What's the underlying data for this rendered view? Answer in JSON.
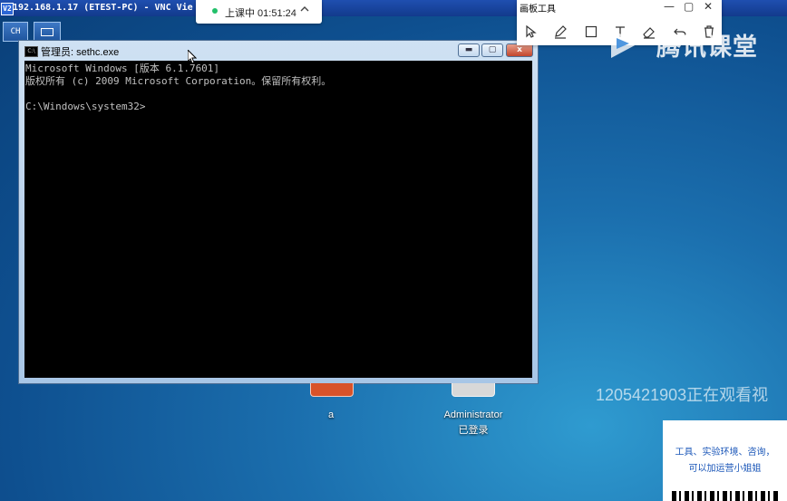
{
  "vnc": {
    "logo": "V2",
    "title": "192.168.1.17 (ETEST-PC) - VNC Vie",
    "btn_ch": "CH",
    "keyboard_icon": "keyboard-icon"
  },
  "lesson": {
    "status": "上课中 01:51:24",
    "chevron_icon": "chevron-up-icon"
  },
  "cmd": {
    "title": "管理员: sethc.exe",
    "lines": {
      "l1": "Microsoft Windows [版本 6.1.7601]",
      "l2": "版权所有 (c) 2009 Microsoft Corporation。保留所有权利。",
      "l3": "",
      "l4": "C:\\Windows\\system32>"
    },
    "buttons": {
      "minimize": "▬",
      "maximize": "▢",
      "close": "x"
    }
  },
  "draw_toolbar": {
    "title": "画板工具",
    "controls": {
      "minimize": "—",
      "maximize": "▢",
      "close": "✕"
    },
    "tools": [
      "select-icon",
      "pen-icon",
      "rectangle-icon",
      "text-icon",
      "eraser-icon",
      "undo-icon",
      "delete-icon"
    ]
  },
  "brand": {
    "text": "腾讯课堂"
  },
  "desktop": {
    "icons": [
      {
        "label": "a"
      },
      {
        "label": "Administrator",
        "sublabel": "已登录"
      }
    ]
  },
  "watermark": {
    "text": "1205421903正在观看视"
  },
  "promo": {
    "line1": "工具、实验环境、咨询，",
    "line2": "可以加运营小姐姐"
  },
  "colors": {
    "desktop": "#1b6fae",
    "console_bg": "#000000",
    "console_text": "#c0c0c0",
    "live_dot": "#22c06a"
  }
}
